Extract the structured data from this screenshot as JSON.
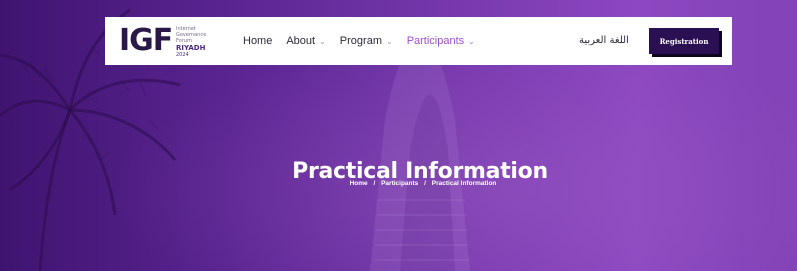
{
  "header": {
    "logo": {
      "mark": "IGF",
      "subtitle_lines": [
        "Internet",
        "Governance",
        "Forum"
      ],
      "city": "RIYADH",
      "year": "2024"
    },
    "nav": [
      {
        "label": "Home",
        "has_dropdown": false,
        "active": false
      },
      {
        "label": "About",
        "has_dropdown": true,
        "active": false
      },
      {
        "label": "Program",
        "has_dropdown": true,
        "active": false
      },
      {
        "label": "Participants",
        "has_dropdown": true,
        "active": true
      }
    ],
    "language_link": "اللغة العربية",
    "register_label": "Registration"
  },
  "hero": {
    "title": "Practical Information",
    "breadcrumb": [
      "Home",
      "Participants",
      "Practical Information"
    ],
    "separator": "/"
  },
  "colors": {
    "accent": "#9b4fd4",
    "button_bg": "#2a0f52",
    "hero_bg": "#6a2fa0"
  }
}
